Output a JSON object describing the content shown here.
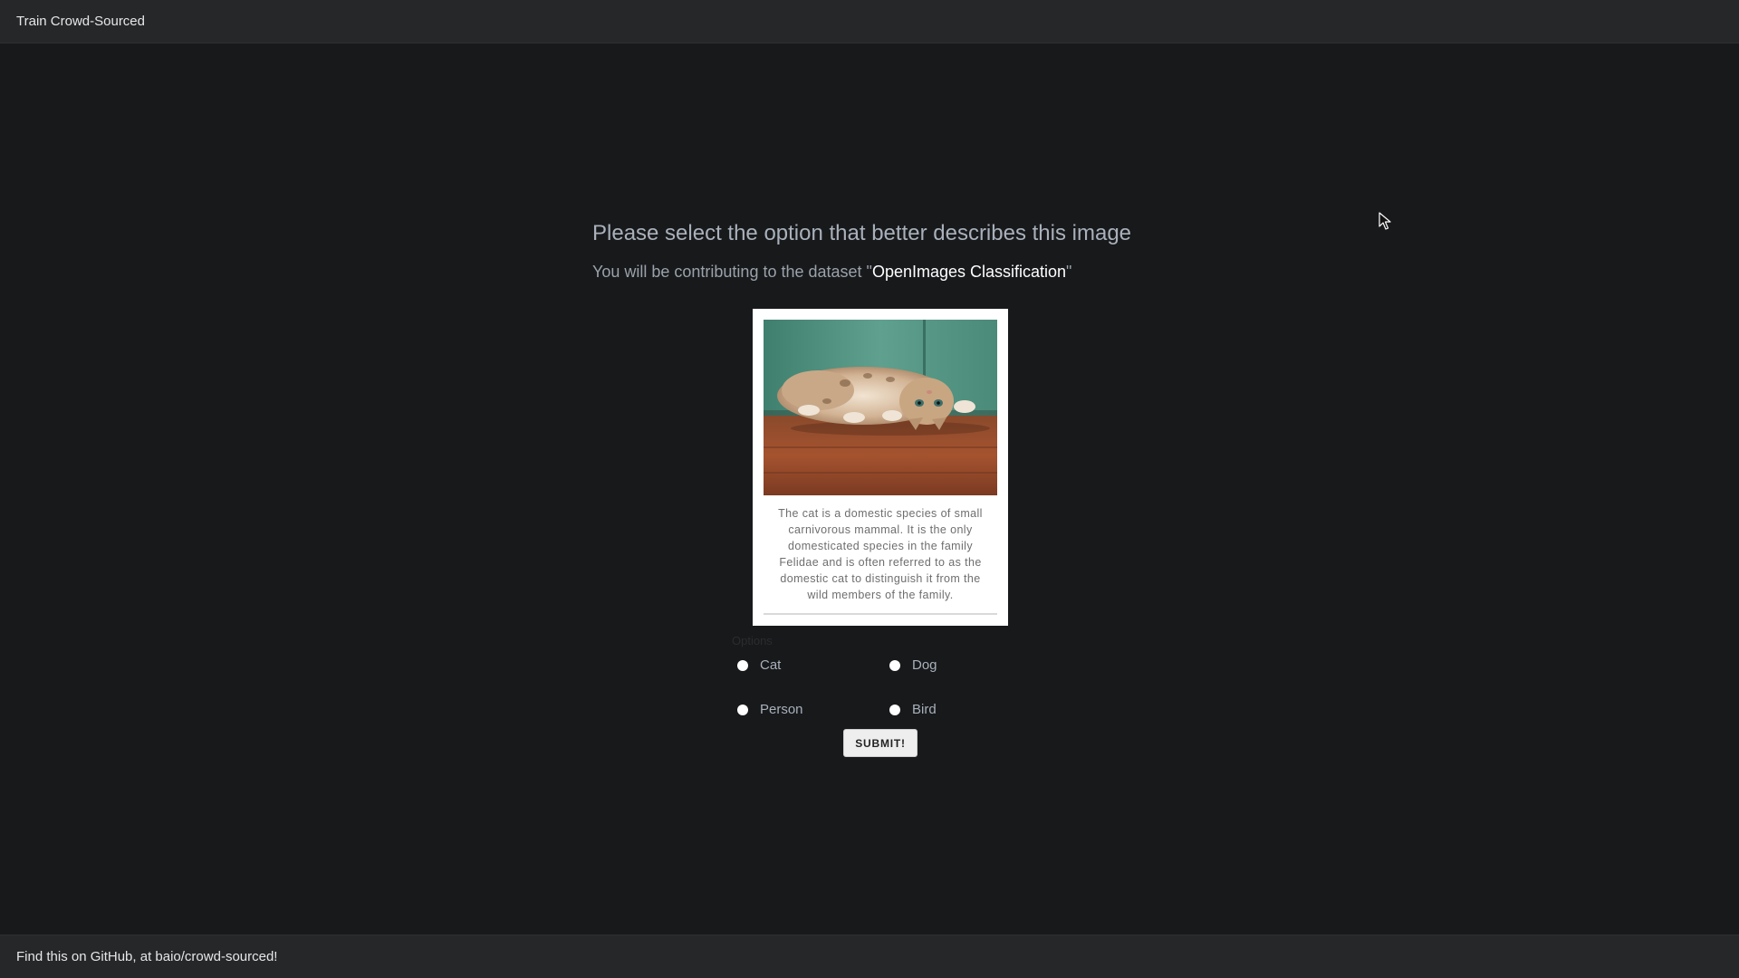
{
  "header": {
    "app_title": "Train Crowd-Sourced"
  },
  "main": {
    "heading": "Please select the option that better describes this image",
    "subheading_prefix": "You will be contributing to the dataset \"",
    "dataset_name": "OpenImages Classification",
    "subheading_suffix": "\"",
    "card": {
      "image_icon": "cat-photo",
      "description": "The cat is a domestic species of small carnivorous mammal. It is the only domesticated species in the family Felidae and is often referred to as the domestic cat to distinguish it from the wild members of the family."
    },
    "options_legend": "Options",
    "options": [
      {
        "label": "Cat",
        "selected": false
      },
      {
        "label": "Dog",
        "selected": false
      },
      {
        "label": "Person",
        "selected": false
      },
      {
        "label": "Bird",
        "selected": false
      }
    ],
    "submit_label": "SUBMIT!"
  },
  "footer": {
    "text": "Find this on GitHub, at baio/crowd-sourced!"
  },
  "colors": {
    "background": "#18191b",
    "bar": "#262728",
    "card": "#ffffff"
  }
}
